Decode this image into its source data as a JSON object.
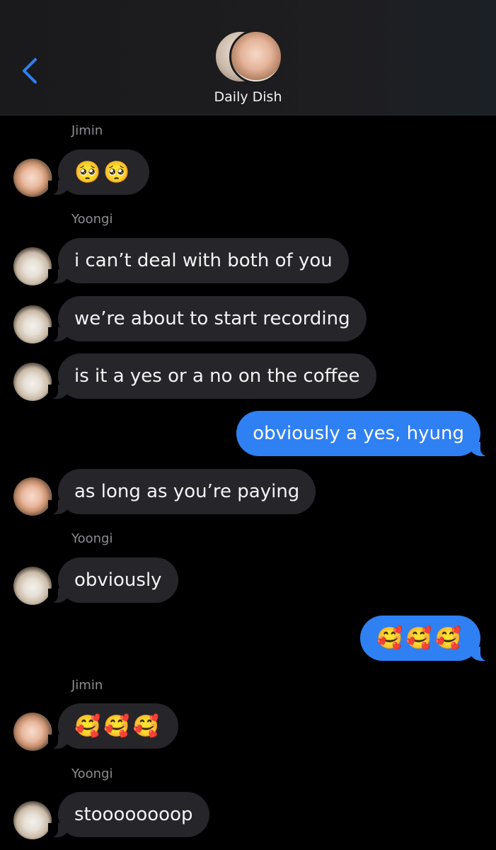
{
  "header": {
    "group_name": "Daily Dish",
    "back_icon": "chevron-left-icon",
    "accent": "#2f80f2"
  },
  "messages": [
    {
      "sender": "Jimin",
      "text": "🥺🥺",
      "direction": "incoming"
    },
    {
      "sender": "Yoongi",
      "text": "i can’t deal with both of you",
      "direction": "incoming"
    },
    {
      "text": "we’re about to start recording",
      "direction": "incoming"
    },
    {
      "text": "is it a yes or a no on the coffee",
      "direction": "incoming"
    },
    {
      "text": "obviously a yes, hyung",
      "direction": "outgoing"
    },
    {
      "text": "as long as you’re paying",
      "direction": "incoming"
    },
    {
      "sender": "Yoongi",
      "text": "obviously",
      "direction": "incoming"
    },
    {
      "text": "🥰🥰🥰",
      "direction": "outgoing"
    },
    {
      "sender": "Jimin",
      "text": "🥰🥰🥰",
      "direction": "incoming"
    },
    {
      "sender": "Yoongi",
      "text": "stoooooooop",
      "direction": "incoming"
    }
  ],
  "colors": {
    "incoming_bubble": "#26252a",
    "outgoing_bubble": "#2f80f2",
    "background": "#000000"
  }
}
